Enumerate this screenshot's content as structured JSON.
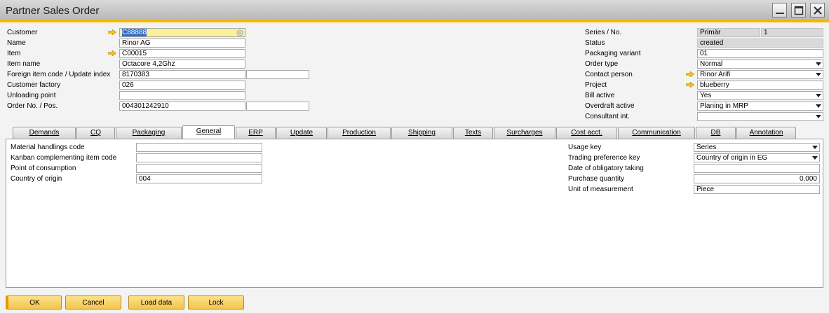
{
  "window": {
    "title": "Partner Sales Order"
  },
  "header_left": [
    {
      "label": "Customer",
      "value": "C88888",
      "arrow": true
    },
    {
      "label": "Name",
      "value": "Rinor AG"
    },
    {
      "label": "Item",
      "value": "C00015",
      "arrow": true
    },
    {
      "label": "Item name",
      "value": "Octacore 4,2Ghz"
    },
    {
      "label": "Foreign item code / Update index",
      "value": "8170383",
      "value2": ""
    },
    {
      "label": "Customer factory",
      "value": "026"
    },
    {
      "label": "Unloading point",
      "value": ""
    },
    {
      "label": "Order No. / Pos.",
      "value": "004301242910",
      "value2": ""
    }
  ],
  "header_right": [
    {
      "label": "Series / No.",
      "value": "Primär",
      "value2": "1"
    },
    {
      "label": "Status",
      "value": "created"
    },
    {
      "label": "Packaging variant",
      "value": "01"
    },
    {
      "label": "Order type",
      "value": "Normal"
    },
    {
      "label": "Contact person",
      "value": "Rinor Arifi",
      "arrow": true
    },
    {
      "label": "Project",
      "value": "blueberry",
      "arrow": true
    },
    {
      "label": "Bill active",
      "value": "Yes"
    },
    {
      "label": "Overdraft active",
      "value": "Planing in MRP"
    },
    {
      "label": "Consultant int.",
      "value": ""
    }
  ],
  "tabs": [
    "Demands",
    "CQ",
    "Packaging",
    "General",
    "ERP",
    "Update",
    "Production",
    "Shipping",
    "Texts",
    "Surcharges",
    "Cost acct.",
    "Communication",
    "DB",
    "Annotation"
  ],
  "active_tab": "General",
  "general_left": [
    {
      "label": "Material handlings code",
      "value": ""
    },
    {
      "label": "Kanban complementing item code",
      "value": ""
    },
    {
      "label": "Point of consumption",
      "value": ""
    },
    {
      "label": "Country of origin",
      "value": "004"
    }
  ],
  "general_right": [
    {
      "label": "Usage key",
      "value": "Series"
    },
    {
      "label": "Trading preference key",
      "value": "Country of origin in EG"
    },
    {
      "label": "Date of obligatory taking",
      "value": ""
    },
    {
      "label": "Purchase quantity",
      "value": "0,000"
    },
    {
      "label": "Unit of measurement",
      "value": "Piece"
    }
  ],
  "buttons": {
    "ok": "OK",
    "cancel": "Cancel",
    "load": "Load data",
    "lock": "Lock"
  },
  "colors": {
    "accent": "#f7b500",
    "button": "#f4c44e",
    "arrow": "#f0c419"
  }
}
